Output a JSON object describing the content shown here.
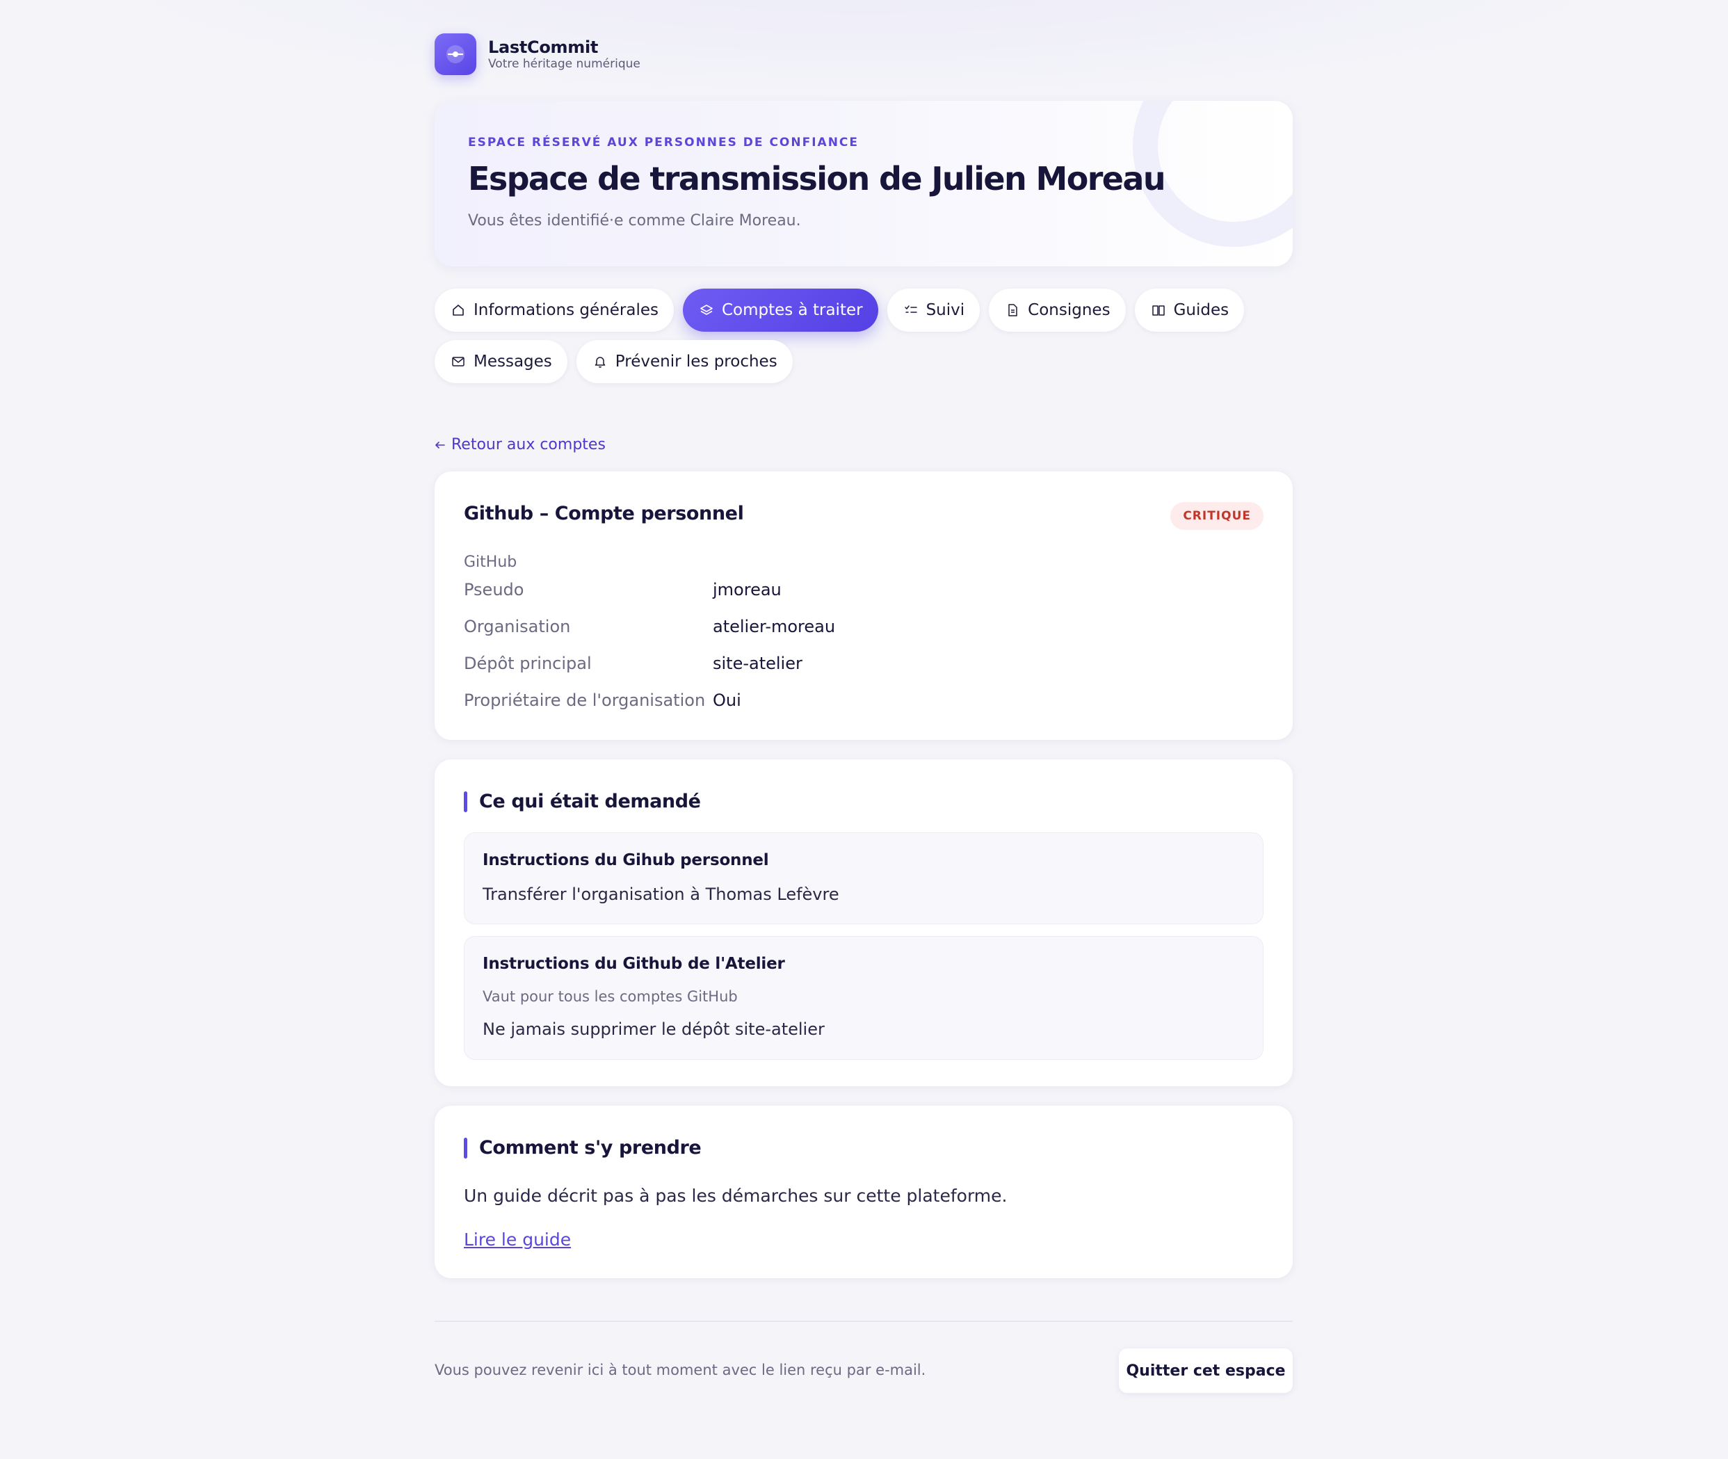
{
  "brand": {
    "name": "LastCommit",
    "tagline": "Votre héritage numérique"
  },
  "hero": {
    "eyebrow": "ESPACE RÉSERVÉ AUX PERSONNES DE CONFIANCE",
    "title": "Espace de transmission de Julien Moreau",
    "subtitle": "Vous êtes identifié·e comme Claire Moreau."
  },
  "tabs": [
    {
      "label": "Informations générales",
      "icon": "home-icon"
    },
    {
      "label": "Comptes à traiter",
      "icon": "layers-icon",
      "active": true
    },
    {
      "label": "Suivi",
      "icon": "checklist-icon"
    },
    {
      "label": "Consignes",
      "icon": "document-icon"
    },
    {
      "label": "Guides",
      "icon": "book-icon"
    },
    {
      "label": "Messages",
      "icon": "mail-icon"
    },
    {
      "label": "Prévenir les proches",
      "icon": "bell-icon"
    }
  ],
  "back_link": {
    "label": "Retour aux comptes",
    "icon": "arrow-left-icon"
  },
  "account": {
    "title": "Github – Compte personnel",
    "badge": "CRITIQUE",
    "platform": "GitHub",
    "fields": [
      {
        "label": "Pseudo",
        "value": "jmoreau"
      },
      {
        "label": "Organisation",
        "value": "atelier-moreau"
      },
      {
        "label": "Dépôt principal",
        "value": "site-atelier"
      },
      {
        "label": "Propriétaire de l'organisation",
        "value": "Oui"
      }
    ]
  },
  "requested": {
    "title": "Ce qui était demandé",
    "items": [
      {
        "title": "Instructions du Gihub personnel",
        "scope": "",
        "text": "Transférer l'organisation à Thomas Lefèvre"
      },
      {
        "title": "Instructions du Github de l'Atelier",
        "scope": "Vaut pour tous les comptes GitHub",
        "text": "Ne jamais supprimer le dépôt site-atelier"
      }
    ]
  },
  "how": {
    "title": "Comment s'y prendre",
    "text": "Un guide décrit pas à pas les démarches sur cette plateforme.",
    "link": "Lire le guide"
  },
  "footer": {
    "note": "Vous pouvez revenir ici à tout moment avec le lien reçu par e-mail.",
    "quit_label": "Quitter cet espace"
  },
  "colors": {
    "accent": "#5a46e6",
    "critical": "#c0362a",
    "critical_bg": "#fdeceb",
    "text": "#17153a"
  }
}
